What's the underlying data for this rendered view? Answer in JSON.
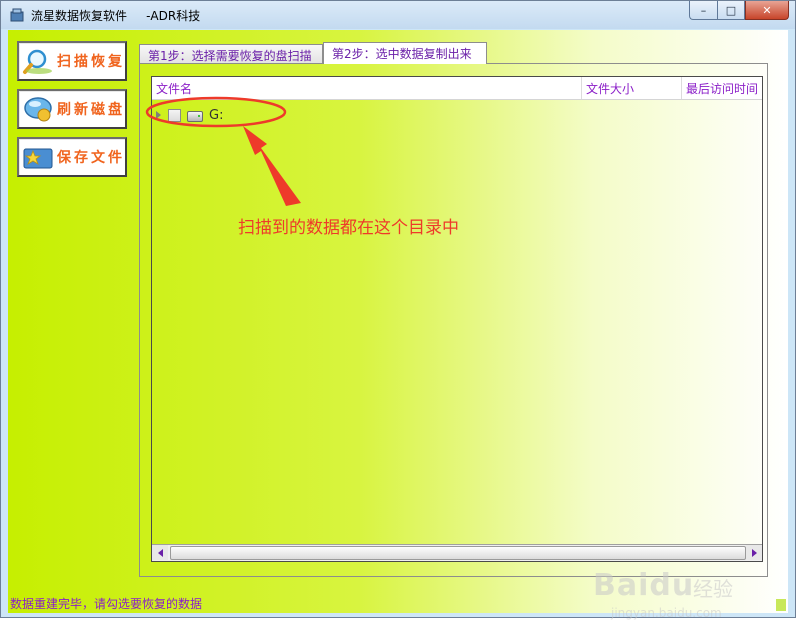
{
  "window": {
    "title": "流星数据恢复软件     -ADR科技",
    "controls": {
      "minimize": "–",
      "maximize": "□",
      "close": "✕"
    }
  },
  "sidebar": {
    "items": [
      {
        "label": "扫描恢复",
        "icon": "magnifier-icon"
      },
      {
        "label": "刷新磁盘",
        "icon": "disk-refresh-icon"
      },
      {
        "label": "保存文件",
        "icon": "save-folder-icon"
      }
    ]
  },
  "tabs": [
    {
      "label": "第1步：选择需要恢复的盘扫描",
      "active": false
    },
    {
      "label": "第2步：选中数据复制出来",
      "active": true
    }
  ],
  "tree": {
    "columns": [
      "文件名",
      "文件大小",
      "最后访问时间"
    ],
    "rows": [
      {
        "label": "G:",
        "checked": false,
        "expanded": false,
        "icon": "drive-icon"
      }
    ]
  },
  "annotation": {
    "text": "扫描到的数据都在这个目录中",
    "color": "#ee3a2a"
  },
  "statusbar": {
    "text": "数据重建完毕，请勾选要恢复的数据"
  },
  "watermark": {
    "logo": "Baidu",
    "sub": "jingyan.baidu.com",
    "suffix": "经验"
  },
  "colors": {
    "accent_text": "#8b1fc8",
    "button_label": "#f0641e",
    "background_start": "#c6ef00",
    "annotation": "#ee3a2a"
  }
}
